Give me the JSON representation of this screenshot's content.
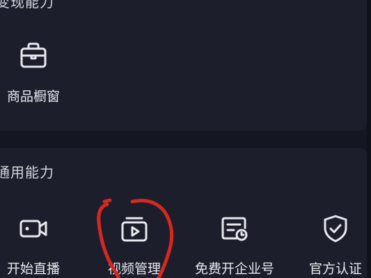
{
  "sections": {
    "monetize": {
      "title": "变现能力",
      "items": [
        {
          "label": "商品橱窗",
          "icon": "shop-bag-icon"
        }
      ]
    },
    "general": {
      "title": "通用能力",
      "items": [
        {
          "label": "开始直播",
          "icon": "video-camera-icon"
        },
        {
          "label": "视频管理",
          "icon": "video-folder-icon"
        },
        {
          "label": "免费开企业号",
          "icon": "enterprise-clock-icon"
        },
        {
          "label": "官方认证",
          "icon": "shield-check-icon"
        }
      ]
    }
  },
  "colors": {
    "background": "#141722",
    "card": "#1c1f2b",
    "text": "#e8e9ee",
    "annotation": "#d7281f"
  }
}
